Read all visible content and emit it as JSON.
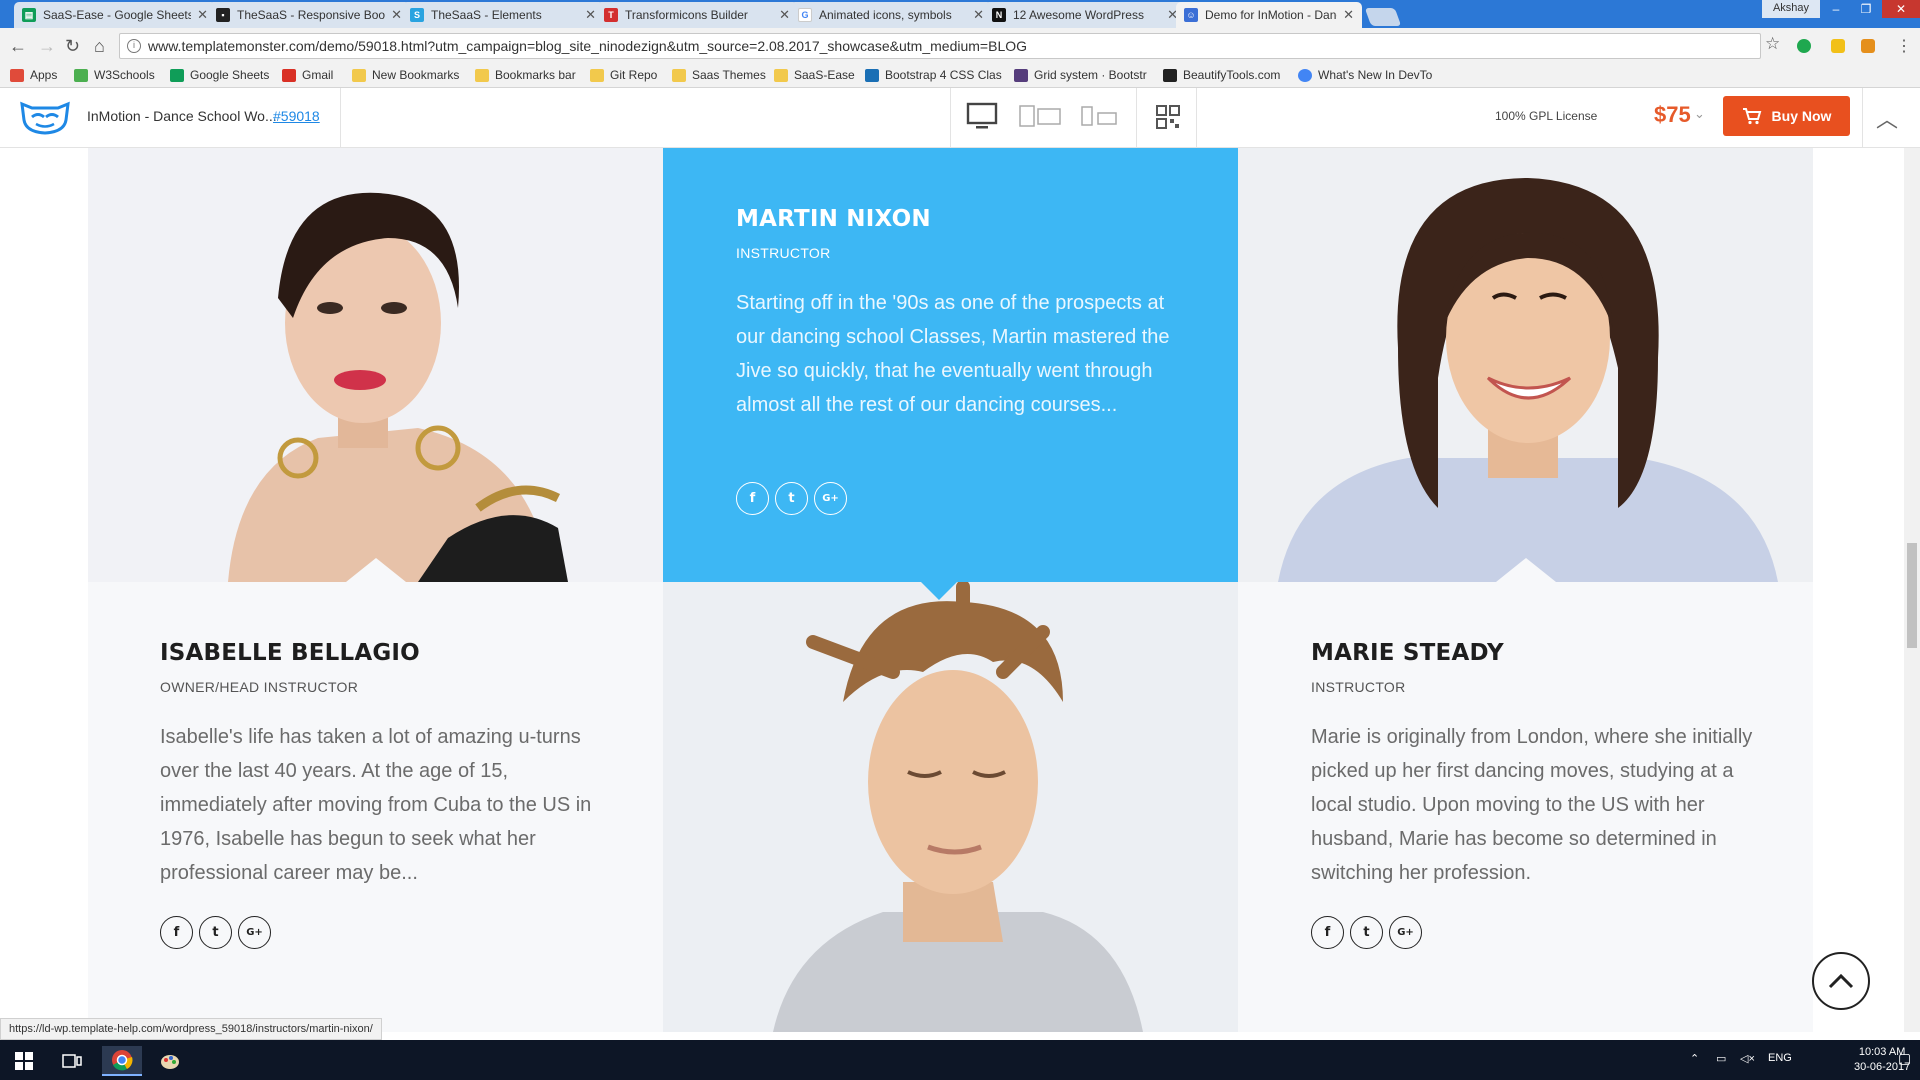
{
  "browser": {
    "tabs": [
      {
        "title": "SaaS-Ease - Google Sheets",
        "favicon": "sheets-icon",
        "color": "#0f9d58",
        "active": false
      },
      {
        "title": "TheSaaS - Responsive Bootstrap",
        "favicon": "thesaas-icon",
        "color": "#222222",
        "active": false
      },
      {
        "title": "TheSaaS - Elements",
        "favicon": "thesaas-s-icon",
        "color": "#29a3e0",
        "active": false
      },
      {
        "title": "Transformicons Builder",
        "favicon": "transformicons-icon",
        "color": "#d32f2f",
        "active": false
      },
      {
        "title": "Animated icons, symbols",
        "favicon": "google-icon",
        "color": "#4285f4",
        "active": false
      },
      {
        "title": "12 Awesome WordPress",
        "favicon": "wp-n-icon",
        "color": "#111111",
        "active": false
      },
      {
        "title": "Demo for InMotion - Dance",
        "favicon": "tm-icon",
        "color": "#3b6fd6",
        "active": true
      }
    ],
    "user": "Akshay",
    "url": "www.templatemonster.com/demo/59018.html?utm_campaign=blog_site_ninodezign&utm_source=2.08.2017_showcase&utm_medium=BLOG",
    "bookmarks": [
      {
        "label": "Apps",
        "icon": "apps-grid-icon",
        "color": "#e04b3a"
      },
      {
        "label": "W3Schools",
        "icon": "w3-icon",
        "color": "#4caf50"
      },
      {
        "label": "Google Sheets",
        "icon": "sheets-icon",
        "color": "#0f9d58"
      },
      {
        "label": "Gmail",
        "icon": "gmail-icon",
        "color": "#d93025"
      },
      {
        "label": "New Bookmarks",
        "icon": "folder-icon",
        "color": "#f2c94c"
      },
      {
        "label": "Bookmarks bar",
        "icon": "folder-icon",
        "color": "#f2c94c"
      },
      {
        "label": "Git Repo",
        "icon": "folder-icon",
        "color": "#f2c94c"
      },
      {
        "label": "Saas Themes",
        "icon": "folder-icon",
        "color": "#f2c94c"
      },
      {
        "label": "SaaS-Ease",
        "icon": "folder-icon",
        "color": "#f2c94c"
      },
      {
        "label": "Bootstrap 4 CSS Clas",
        "icon": "bs-icon",
        "color": "#1a6fb5"
      },
      {
        "label": "Grid system · Bootstr",
        "icon": "bootstrap-icon",
        "color": "#563d7c"
      },
      {
        "label": "BeautifyTools.com",
        "icon": "bt-icon",
        "color": "#222222"
      },
      {
        "label": "What's New In DevTo",
        "icon": "chrome-icon",
        "color": "#4285f4"
      }
    ],
    "status_url": "https://ld-wp.template-help.com/wordpress_59018/instructors/martin-nixon/"
  },
  "demo_bar": {
    "title": "InMotion - Dance School Wo...",
    "template_id": "#59018",
    "license": "100% GPL License",
    "price": "$75",
    "buy_label": "Buy Now"
  },
  "instructors": [
    {
      "name": "ISABELLE BELLAGIO",
      "role": "OWNER/HEAD INSTRUCTOR",
      "bio": "Isabelle's life has taken a lot of amazing u-turns over the last 40 years. At the age of 15, immediately after moving from Cuba to the US in 1976, Isabelle has begun to seek what her professional career may be..."
    },
    {
      "name": "MARTIN NIXON",
      "role": "INSTRUCTOR",
      "bio": "Starting off in the '90s as one of the prospects at our dancing school Classes, Martin mastered  the Jive so quickly, that he eventually went through almost all the rest of our dancing courses..."
    },
    {
      "name": "MARIE STEADY",
      "role": "INSTRUCTOR",
      "bio": "Marie is originally from London, where she initially picked up her first dancing moves, studying at a local studio. Upon moving to the US with her husband, Marie has become so determined in switching her profession."
    }
  ],
  "social_labels": {
    "facebook": "f",
    "twitter": "t",
    "google_plus": "G+"
  },
  "colors": {
    "accent_blue": "#3db7f4",
    "buy_orange": "#e8501f",
    "price_orange": "#e65a2a",
    "heading_dark": "#1e1e1e",
    "body_gray": "#6b6b6b"
  },
  "taskbar": {
    "lang": "ENG",
    "time": "10:03 AM",
    "date": "30-06-2017"
  }
}
